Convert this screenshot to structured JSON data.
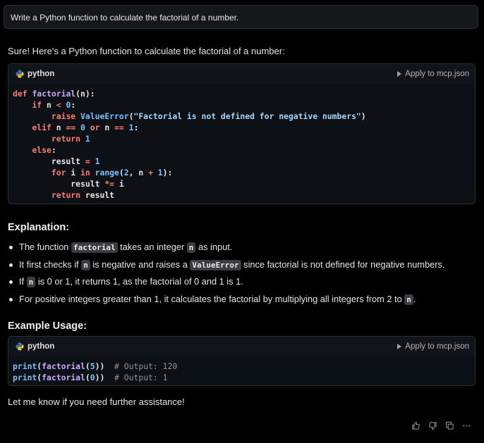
{
  "user_message": "Write a Python function to calculate the factorial of a number.",
  "intro": "Sure! Here's a Python function to calculate the factorial of a number:",
  "code_block_1": {
    "language": "python",
    "apply_label": "Apply to mcp.json"
  },
  "explanation": {
    "heading": "Explanation:",
    "b1_pre": "The function ",
    "b1_code": "factorial",
    "b1_mid": " takes an integer ",
    "b1_code2": "n",
    "b1_post": " as input.",
    "b2_pre": "It first checks if ",
    "b2_code": "n",
    "b2_mid": " is negative and raises a ",
    "b2_code2": "ValueError",
    "b2_post": " since factorial is not defined for negative numbers.",
    "b3_pre": "If ",
    "b3_code": "n",
    "b3_post": " is 0 or 1, it returns 1, as the factorial of 0 and 1 is 1.",
    "b4_pre": "For positive integers greater than 1, it calculates the factorial by multiplying all integers from 2 to ",
    "b4_code": "n",
    "b4_post": "."
  },
  "example": {
    "heading": "Example Usage:"
  },
  "code_block_2": {
    "language": "python",
    "apply_label": "Apply to mcp.json"
  },
  "closing": "Let me know if you need further assistance!",
  "actions": [
    "thumbs-up-icon",
    "thumbs-down-icon",
    "copy-icon",
    "more-icon"
  ]
}
